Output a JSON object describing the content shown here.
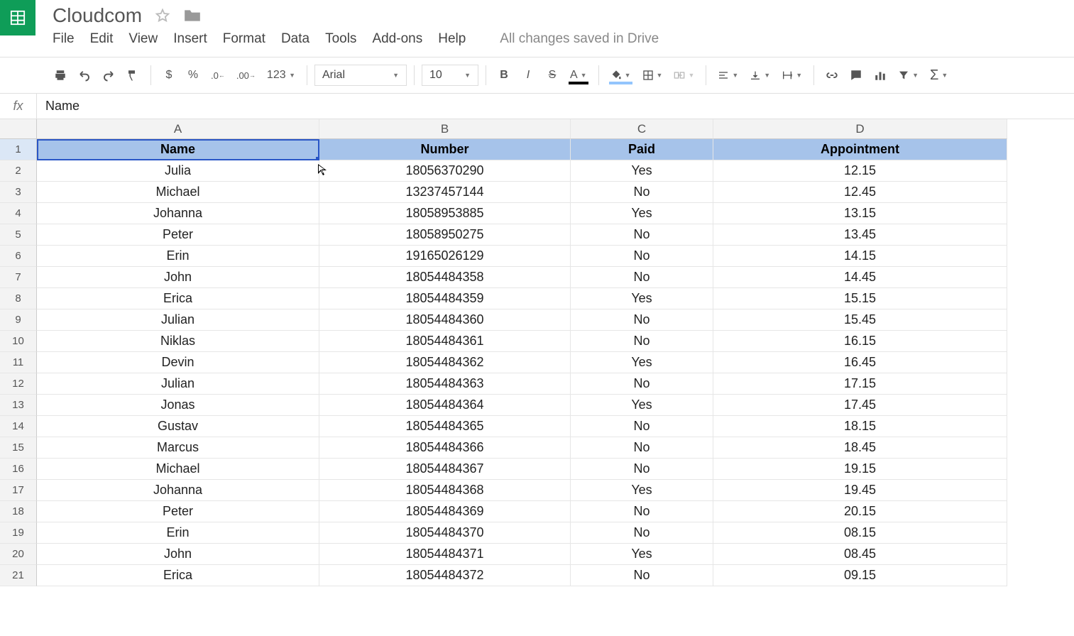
{
  "doc": {
    "title": "Cloudcom",
    "save_status": "All changes saved in Drive"
  },
  "menu": {
    "file": "File",
    "edit": "Edit",
    "view": "View",
    "insert": "Insert",
    "format": "Format",
    "data": "Data",
    "tools": "Tools",
    "addons": "Add-ons",
    "help": "Help"
  },
  "toolbar": {
    "font": "Arial",
    "size": "10",
    "currency": "$",
    "percent": "%",
    "dec_dec": ".0←",
    "inc_dec": ".00→",
    "num_fmt": "123"
  },
  "fx": {
    "value": "Name"
  },
  "columns": [
    "A",
    "B",
    "C",
    "D"
  ],
  "col_widths": [
    "colA",
    "colB",
    "colC",
    "colD"
  ],
  "headers": [
    "Name",
    "Number",
    "Paid",
    "Appointment"
  ],
  "rows": [
    {
      "n": "2",
      "cells": [
        "Julia",
        "18056370290",
        "Yes",
        "12.15"
      ]
    },
    {
      "n": "3",
      "cells": [
        "Michael",
        "13237457144",
        "No",
        "12.45"
      ]
    },
    {
      "n": "4",
      "cells": [
        "Johanna",
        "18058953885",
        "Yes",
        "13.15"
      ]
    },
    {
      "n": "5",
      "cells": [
        "Peter",
        "18058950275",
        "No",
        "13.45"
      ]
    },
    {
      "n": "6",
      "cells": [
        "Erin",
        "19165026129",
        "No",
        "14.15"
      ]
    },
    {
      "n": "7",
      "cells": [
        "John",
        "18054484358",
        "No",
        "14.45"
      ]
    },
    {
      "n": "8",
      "cells": [
        "Erica",
        "18054484359",
        "Yes",
        "15.15"
      ]
    },
    {
      "n": "9",
      "cells": [
        "Julian",
        "18054484360",
        "No",
        "15.45"
      ]
    },
    {
      "n": "10",
      "cells": [
        "Niklas",
        "18054484361",
        "No",
        "16.15"
      ]
    },
    {
      "n": "11",
      "cells": [
        "Devin",
        "18054484362",
        "Yes",
        "16.45"
      ]
    },
    {
      "n": "12",
      "cells": [
        "Julian",
        "18054484363",
        "No",
        "17.15"
      ]
    },
    {
      "n": "13",
      "cells": [
        "Jonas",
        "18054484364",
        "Yes",
        "17.45"
      ]
    },
    {
      "n": "14",
      "cells": [
        "Gustav",
        "18054484365",
        "No",
        "18.15"
      ]
    },
    {
      "n": "15",
      "cells": [
        "Marcus",
        "18054484366",
        "No",
        "18.45"
      ]
    },
    {
      "n": "16",
      "cells": [
        "Michael",
        "18054484367",
        "No",
        "19.15"
      ]
    },
    {
      "n": "17",
      "cells": [
        "Johanna",
        "18054484368",
        "Yes",
        "19.45"
      ]
    },
    {
      "n": "18",
      "cells": [
        "Peter",
        "18054484369",
        "No",
        "20.15"
      ]
    },
    {
      "n": "19",
      "cells": [
        "Erin",
        "18054484370",
        "No",
        "08.15"
      ]
    },
    {
      "n": "20",
      "cells": [
        "John",
        "18054484371",
        "Yes",
        "08.45"
      ]
    },
    {
      "n": "21",
      "cells": [
        "Erica",
        "18054484372",
        "No",
        "09.15"
      ]
    }
  ],
  "active_cell": {
    "row_idx": 0,
    "col_idx": 0
  }
}
